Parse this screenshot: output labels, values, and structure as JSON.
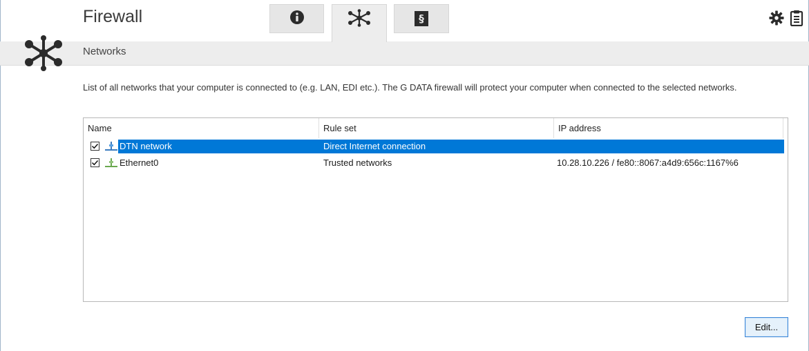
{
  "app": {
    "title": "Firewall"
  },
  "tabs": [
    {
      "name": "info",
      "icon": "info-circle-icon",
      "active": false
    },
    {
      "name": "networks",
      "icon": "network-icon",
      "active": true
    },
    {
      "name": "rules",
      "icon": "section-sign-icon",
      "glyph": "§",
      "active": false
    }
  ],
  "toolbar": {
    "settings_icon": "gear-icon",
    "log_icon": "clipboard-icon"
  },
  "section": {
    "title": "Networks",
    "icon": "network-icon"
  },
  "description": "List of all networks that your computer is connected to (e.g. LAN, EDI etc.). The G DATA firewall will protect your computer when connected to the selected networks.",
  "table": {
    "columns": [
      "Name",
      "Rule set",
      "IP address"
    ],
    "rows": [
      {
        "checked": true,
        "name": "DTN network",
        "rule_set": "Direct Internet connection",
        "ip": "",
        "selected": true,
        "icon": "network-adapter-icon"
      },
      {
        "checked": true,
        "name": "Ethernet0",
        "rule_set": "Trusted networks",
        "ip": "10.28.10.226 / fe80::8067:a4d9:656c:1167%6",
        "selected": false,
        "icon": "network-adapter-icon"
      }
    ]
  },
  "buttons": {
    "edit_label": "Edit..."
  },
  "colors": {
    "selection": "#0078d7",
    "band": "#ededed",
    "icon_dark": "#2b2b2b"
  }
}
